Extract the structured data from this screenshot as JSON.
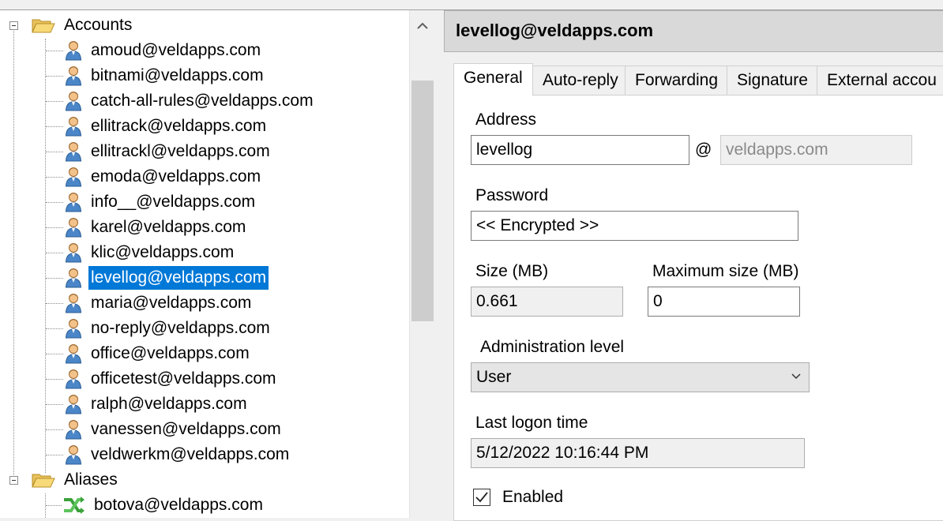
{
  "tree": {
    "accounts_label": "Accounts",
    "aliases_label": "Aliases",
    "accounts": [
      "amoud@veldapps.com",
      "bitnami@veldapps.com",
      "catch-all-rules@veldapps.com",
      "ellitrack@veldapps.com",
      "ellitrackl@veldapps.com",
      "emoda@veldapps.com",
      "info__@veldapps.com",
      "karel@veldapps.com",
      "klic@veldapps.com",
      "levellog@veldapps.com",
      "maria@veldapps.com",
      "no-reply@veldapps.com",
      "office@veldapps.com",
      "officetest@veldapps.com",
      "ralph@veldapps.com",
      "vanessen@veldapps.com",
      "veldwerkm@veldapps.com"
    ],
    "aliases": [
      "botova@veldapps.com"
    ],
    "selected": "levellog@veldapps.com"
  },
  "detail": {
    "title": "levellog@veldapps.com",
    "tabs": [
      "General",
      "Auto-reply",
      "Forwarding",
      "Signature",
      "External accou"
    ],
    "active_tab": "General",
    "address_label": "Address",
    "address_user": "levellog",
    "at_sign": "@",
    "address_domain": "veldapps.com",
    "password_label": "Password",
    "password_value": "<< Encrypted >>",
    "size_label": "Size (MB)",
    "size_value": "0.661",
    "max_size_label": "Maximum size (MB)",
    "max_size_value": "0",
    "admin_level_label": "Administration level",
    "admin_level_value": "User",
    "last_logon_label": "Last logon time",
    "last_logon_value": "5/12/2022 10:16:44 PM",
    "enabled_label": "Enabled",
    "enabled_checked": true
  },
  "colors": {
    "selection": "#0078d7",
    "header_bg": "#d9d9d9"
  }
}
